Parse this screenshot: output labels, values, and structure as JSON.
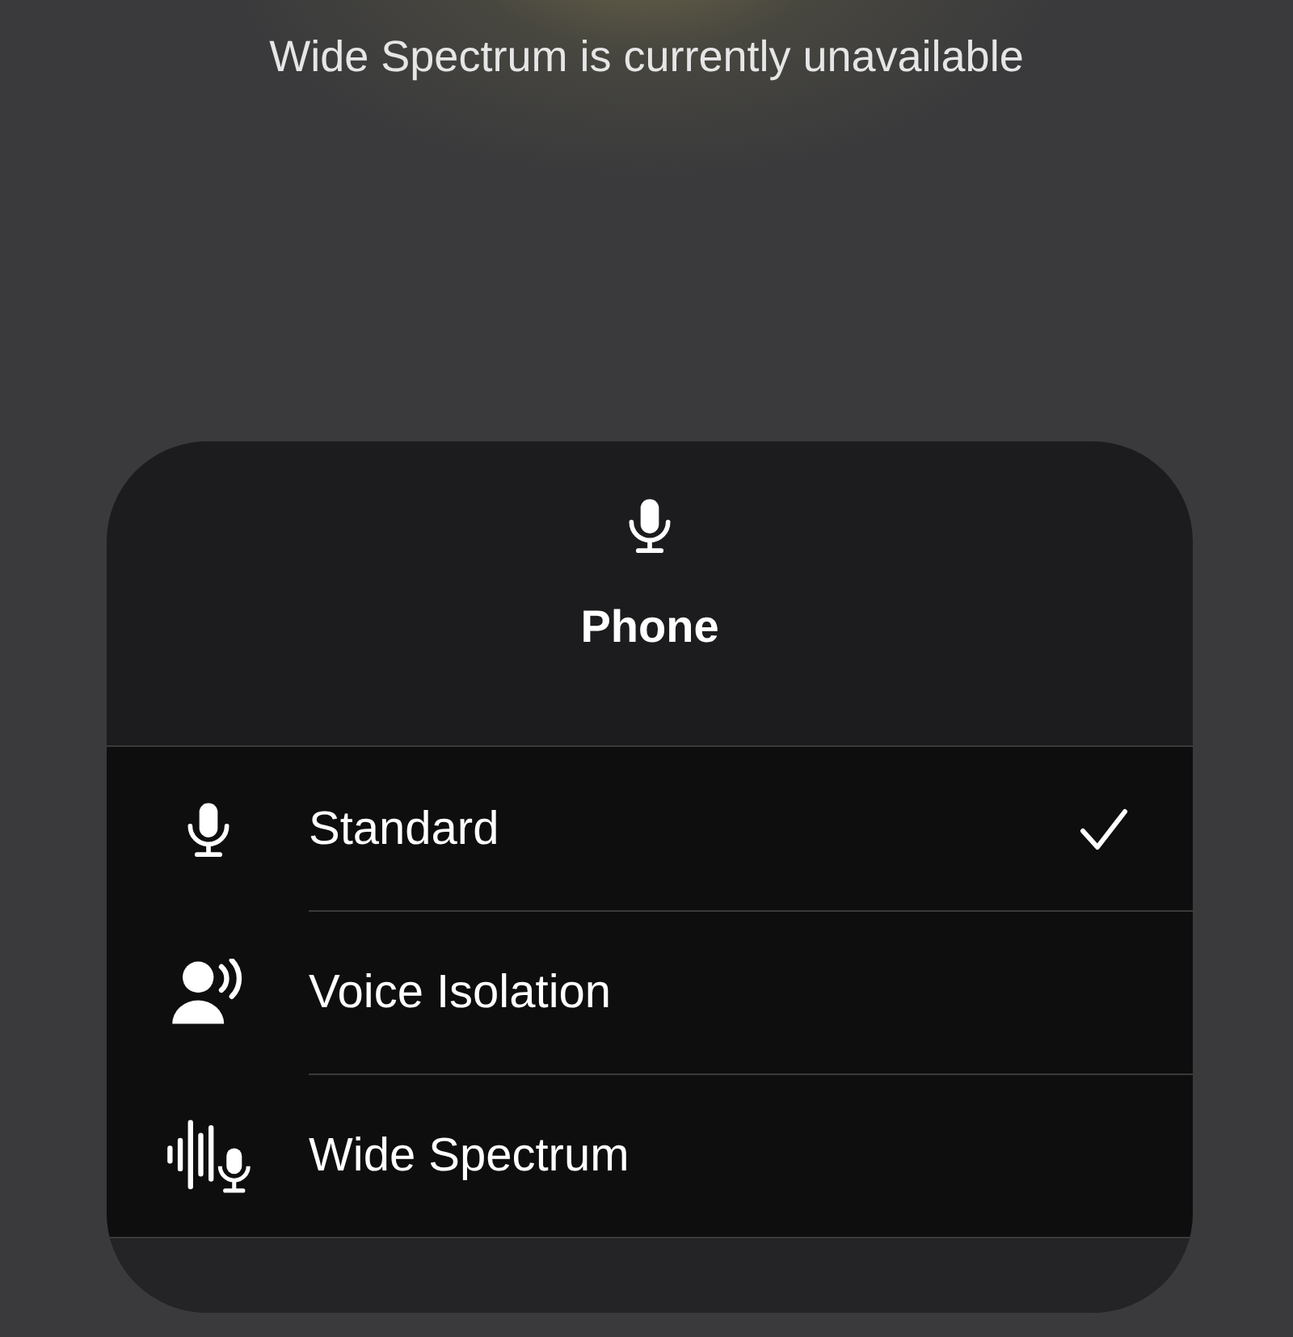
{
  "banner": "Wide Spectrum is currently unavailable",
  "header": {
    "title": "Phone"
  },
  "modes": [
    {
      "kind": "microphone",
      "label": "Standard",
      "selected": true
    },
    {
      "kind": "voice",
      "label": "Voice Isolation",
      "selected": false
    },
    {
      "kind": "spectrum",
      "label": "Wide Spectrum",
      "selected": false
    }
  ]
}
